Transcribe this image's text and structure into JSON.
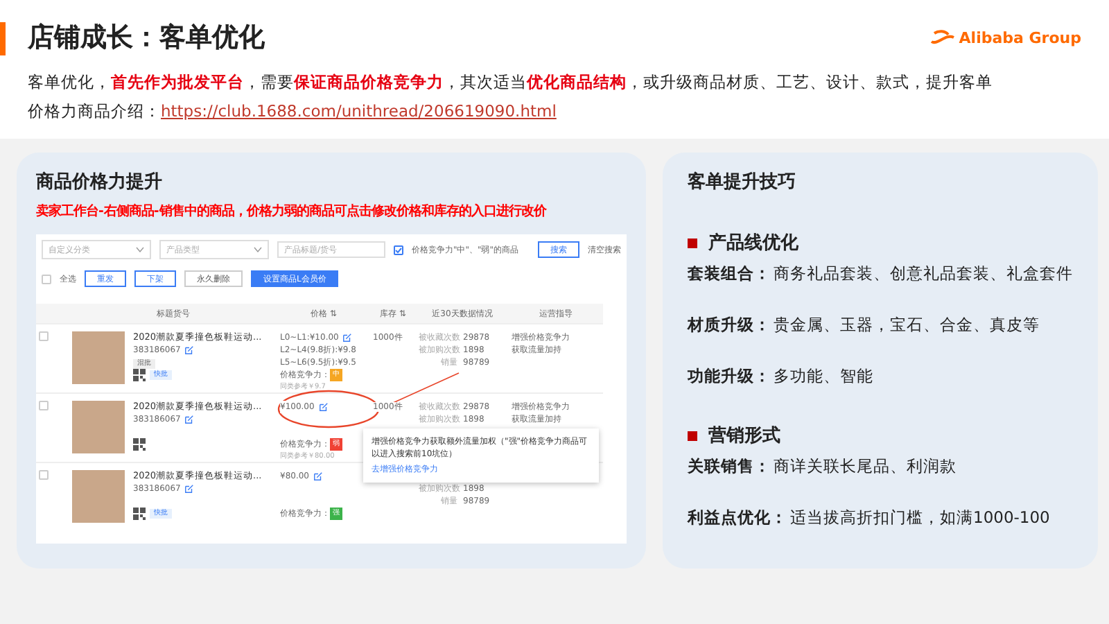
{
  "header": {
    "title": "店铺成长：客单优化",
    "logo": "Alibaba Group",
    "intro": "客单优化，**首先作为批发平台**，需要**保证商品价格竞争力**，其次适当**优化商品结构**，或升级商品材质、工艺、设计、款式，提升客单",
    "link_label": "价格力商品介绍：",
    "link": "https://club.1688.com/unithread/206619090.html"
  },
  "left_panel": {
    "title": "商品价格力提升",
    "note": "卖家工作台-右侧商品-销售中的商品，价格力弱的商品可点击修改价格和库存的入口进行改价",
    "screenshot": {
      "filters": [
        {
          "kind": "select",
          "placeholder": "自定义分类"
        },
        {
          "kind": "select",
          "placeholder": "产品类型"
        },
        {
          "kind": "input",
          "placeholder": "产品标题/货号"
        }
      ],
      "filter_check": {
        "label": "价格竞争力\"中\"、\"弱\"的商品",
        "checked": true
      },
      "search_button": "搜索",
      "clear_link": "清空搜索",
      "select_all": {
        "label": "全选",
        "checked": false
      },
      "actions": [
        {
          "label": "重发",
          "kind": "outline"
        },
        {
          "label": "下架",
          "kind": "outline"
        },
        {
          "label": "永久删除",
          "kind": "plain"
        },
        {
          "label": "设置商品L会员价",
          "kind": "primary"
        }
      ],
      "columns": [
        "标题货号",
        "价格 ⇅",
        "库存 ⇅",
        "近30天数据情况",
        "运营指导"
      ],
      "rows": [
        {
          "checked": false,
          "name": "2020潮款夏季撞色板鞋运动...",
          "sku": "383186067",
          "tags": [
            {
              "label": "混批",
              "kind": "gray"
            },
            {
              "label": "快批",
              "kind": "blue"
            }
          ],
          "prices": [
            "L0~L1:¥10.00",
            "L2~L4(9.8折):¥9.8",
            "L5~L6(9.5折):¥9.5"
          ],
          "competition_label": "价格竞争力：",
          "competition": "中",
          "color": "#f5a623",
          "reference": "同类参考￥9.7",
          "stock": "1000件",
          "stats": [
            {
              "label": "被收藏次数",
              "value": "29878"
            },
            {
              "label": "被加购次数",
              "value": "1898"
            },
            {
              "label": "销量",
              "value": "98789"
            }
          ],
          "guidance": [
            "增强价格竞争力",
            "获取流量加持"
          ]
        },
        {
          "checked": false,
          "name": "2020潮款夏季撞色板鞋运动...",
          "sku": "383186067",
          "tags": [],
          "prices": [
            "¥100.00"
          ],
          "competition_label": "价格竞争力：",
          "competition": "弱",
          "color": "#f04134",
          "reference": "同类参考￥80.00",
          "stock": "1000件",
          "stats": [
            {
              "label": "被收藏次数",
              "value": "29878"
            },
            {
              "label": "被加购次数",
              "value": "1898"
            }
          ],
          "guidance": [
            "增强价格竞争力",
            "获取流量加持"
          ]
        },
        {
          "checked": false,
          "name": "2020潮款夏季撞色板鞋运动...",
          "sku": "383186067",
          "tags": [
            {
              "label": "快批",
              "kind": "blue"
            }
          ],
          "prices": [
            "¥80.00"
          ],
          "competition_label": "价格竞争力：",
          "competition": "强",
          "color": "#3cb34a",
          "stats": [
            {
              "label": "被加购次数",
              "value": "1898"
            },
            {
              "label": "销量",
              "value": "98789"
            }
          ],
          "guidance": []
        }
      ],
      "tooltip": {
        "text": "增强价格竞争力获取额外流量加权（\"强\"价格竞争力商品可以进入搜索前10坑位）",
        "link": "去增强价格竞争力"
      }
    }
  },
  "right_panel": {
    "title": "客单提升技巧",
    "sections": [
      {
        "heading": "产品线优化",
        "items": [
          {
            "label": "套装组合：",
            "text": "商务礼品套装、创意礼品套装、礼盒套件"
          },
          {
            "label": "材质升级：",
            "text": "贵金属、玉器，宝石、合金、真皮等"
          },
          {
            "label": "功能升级：",
            "text": "多功能、智能"
          }
        ]
      },
      {
        "heading": "营销形式",
        "items": [
          {
            "label": "关联销售：",
            "text": "商详关联长尾品、利润款"
          },
          {
            "label": "利益点优化：",
            "text": "适当拔高折扣门槛，如满1000-100"
          }
        ]
      }
    ]
  }
}
